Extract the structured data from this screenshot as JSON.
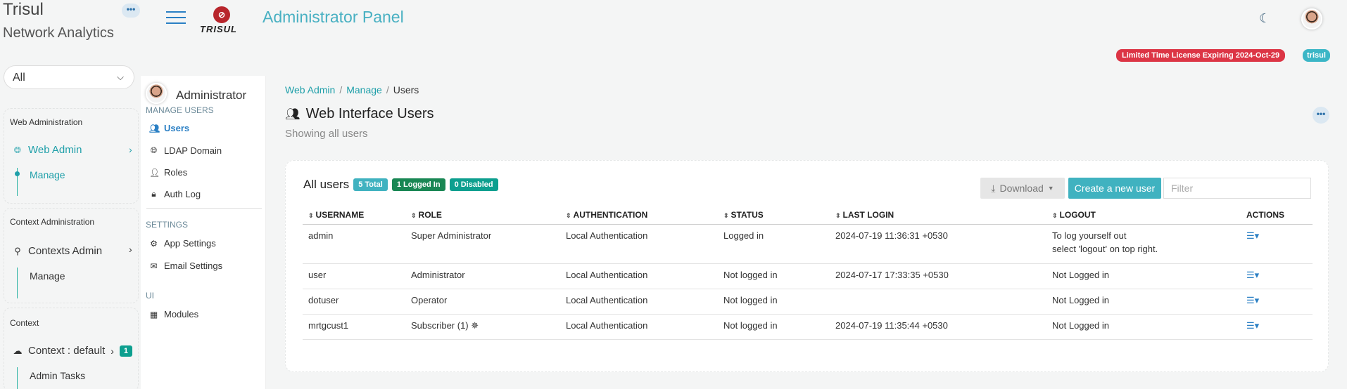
{
  "brand": {
    "line1": "Trisul",
    "line2": "Network Analytics",
    "more_label": "•••"
  },
  "context_select": {
    "value": "All",
    "chevron": "⌄"
  },
  "left_groups": {
    "web": {
      "title": "Web Administration",
      "item": "Web Admin",
      "sub": "Manage"
    },
    "context_admin": {
      "title": "Context Administration",
      "item": "Contexts Admin",
      "sub": "Manage"
    },
    "context": {
      "title": "Context",
      "item": "Context : default",
      "badge": "1",
      "sub": "Admin Tasks"
    }
  },
  "header": {
    "logo_mark": "⊘",
    "logo_text": "TRISUL",
    "title": "Administrator Panel",
    "license_badge": "Limited Time License Expiring 2024-Oct-29",
    "user_badge": "trisul"
  },
  "subnav": {
    "profile_name": "Administrator",
    "sections": {
      "manage": "MANAGE USERS",
      "settings": "SETTINGS",
      "ui": "UI"
    },
    "items": {
      "users": "Users",
      "ldap": "LDAP Domain",
      "roles": "Roles",
      "authlog": "Auth Log",
      "app": "App Settings",
      "email": "Email Settings",
      "modules": "Modules"
    }
  },
  "breadcrumb": [
    "Web Admin",
    "Manage",
    "Users"
  ],
  "page": {
    "title": "Web Interface Users",
    "subtitle": "Showing all users",
    "more_label": "•••"
  },
  "card": {
    "title": "All users",
    "badges": {
      "total": "5 Total",
      "logged_in": "1 Logged In",
      "disabled": "0 Disabled"
    },
    "download_label": "Download",
    "create_label": "Create a new user",
    "filter_placeholder": "Filter"
  },
  "table": {
    "headers": [
      "USERNAME",
      "ROLE",
      "AUTHENTICATION",
      "STATUS",
      "LAST LOGIN",
      "LOGOUT",
      "ACTIONS"
    ],
    "rows": [
      {
        "username": "admin",
        "role": "Super Administrator",
        "auth": "Local Authentication",
        "status": "Logged in",
        "last_login": "2024-07-19 11:36:31 +0530",
        "logout1": "To log yourself out",
        "logout2": "select 'logout' on top right."
      },
      {
        "username": "user",
        "role": "Administrator",
        "auth": "Local Authentication",
        "status": "Not logged in",
        "last_login": "2024-07-17 17:33:35 +0530",
        "logout1": "Not Logged in",
        "logout2": ""
      },
      {
        "username": "dotuser",
        "role": "Operator",
        "auth": "Local Authentication",
        "status": "Not logged in",
        "last_login": "",
        "logout1": "Not Logged in",
        "logout2": ""
      },
      {
        "username": "mrtgcust1",
        "role": "Subscriber (1)",
        "auth": "Local Authentication",
        "status": "Not logged in",
        "last_login": "2024-07-19 11:35:44 +0530",
        "logout1": "Not Logged in",
        "logout2": ""
      }
    ]
  },
  "colors": {
    "accent": "#40b2c0",
    "link": "#1e9fa9",
    "danger": "#dc3545",
    "success": "#198754",
    "teal": "#0d9f8f"
  }
}
